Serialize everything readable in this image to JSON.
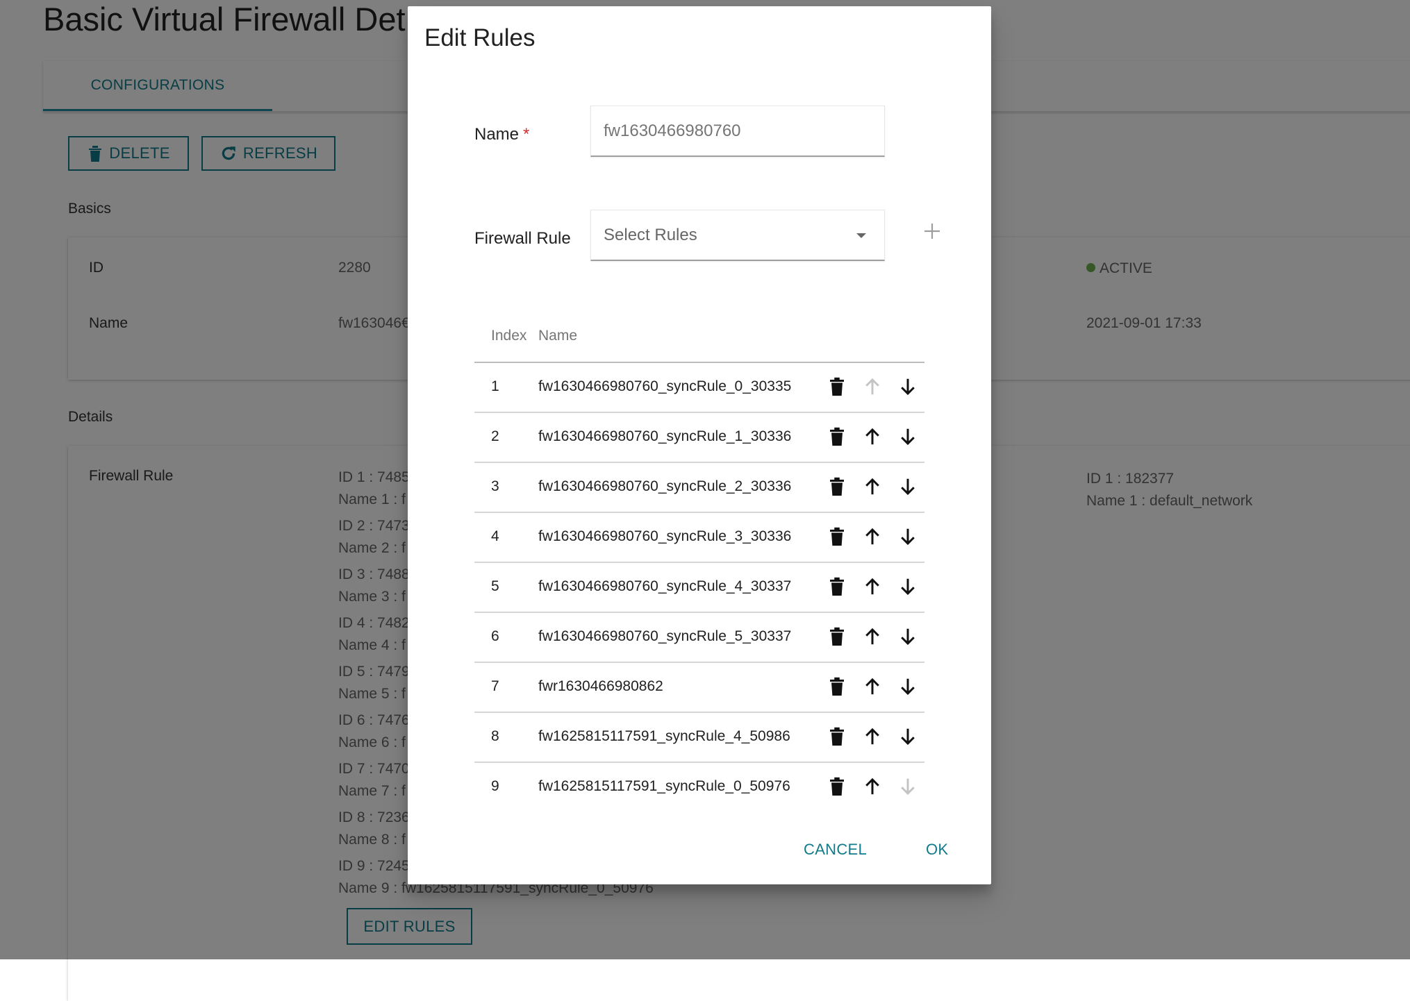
{
  "page": {
    "title": "Basic Virtual Firewall Det",
    "tabs": [
      {
        "label": "CONFIGURATIONS"
      }
    ],
    "toolbar": {
      "delete_label": "DELETE",
      "refresh_label": "REFRESH"
    },
    "basics": {
      "section_label": "Basics",
      "id_label": "ID",
      "id_value": "2280",
      "name_label": "Name",
      "name_value": "fw163046€",
      "status": "ACTIVE",
      "created": "2021-09-01 17:33"
    },
    "details": {
      "section_label": "Details",
      "firewall_rule_label": "Firewall Rule",
      "rules": [
        {
          "id": "ID 1 : 7485",
          "name": "Name 1 : f"
        },
        {
          "id": "ID 2 : 7473",
          "name": "Name 2 : f"
        },
        {
          "id": "ID 3 : 7488",
          "name": "Name 3 : f"
        },
        {
          "id": "ID 4 : 7482",
          "name": "Name 4 : f"
        },
        {
          "id": "ID 5 : 7479",
          "name": "Name 5 : f"
        },
        {
          "id": "ID 6 : 7476",
          "name": "Name 6 : f"
        },
        {
          "id": "ID 7 : 7470",
          "name": "Name 7 : f"
        },
        {
          "id": "ID 8 : 7236",
          "name": "Name 8 : f"
        },
        {
          "id": "ID 9 : 7245",
          "name": "Name 9 : fw1625815117591_syncRule_0_50976"
        }
      ],
      "network_id": "ID 1 : 182377",
      "network_name": "Name 1 : default_network",
      "edit_rules_label": "EDIT RULES"
    }
  },
  "dialog": {
    "title": "Edit Rules",
    "name_label": "Name",
    "required_mark": "*",
    "name_placeholder": "fw1630466980760",
    "firewall_rule_label": "Firewall Rule",
    "select_placeholder": "Select Rules",
    "add_icon": "plus-icon",
    "table": {
      "headers": {
        "index": "Index",
        "name": "Name"
      },
      "rows": [
        {
          "index": "1",
          "name": "fw1630466980760_syncRule_0_30335",
          "up_enabled": false,
          "down_enabled": true
        },
        {
          "index": "2",
          "name": "fw1630466980760_syncRule_1_30336",
          "up_enabled": true,
          "down_enabled": true
        },
        {
          "index": "3",
          "name": "fw1630466980760_syncRule_2_30336",
          "up_enabled": true,
          "down_enabled": true
        },
        {
          "index": "4",
          "name": "fw1630466980760_syncRule_3_30336",
          "up_enabled": true,
          "down_enabled": true
        },
        {
          "index": "5",
          "name": "fw1630466980760_syncRule_4_30337",
          "up_enabled": true,
          "down_enabled": true
        },
        {
          "index": "6",
          "name": "fw1630466980760_syncRule_5_30337",
          "up_enabled": true,
          "down_enabled": true
        },
        {
          "index": "7",
          "name": "fwr1630466980862",
          "up_enabled": true,
          "down_enabled": true
        },
        {
          "index": "8",
          "name": "fw1625815117591_syncRule_4_50986",
          "up_enabled": true,
          "down_enabled": true
        },
        {
          "index": "9",
          "name": "fw1625815117591_syncRule_0_50976",
          "up_enabled": true,
          "down_enabled": false
        }
      ]
    },
    "cancel_label": "CANCEL",
    "ok_label": "OK"
  },
  "colors": {
    "accent": "#117a8b",
    "status_active": "#6ab04c",
    "required": "#d32f2f",
    "icon": "#111111",
    "icon_disabled": "#c4c4c4"
  }
}
